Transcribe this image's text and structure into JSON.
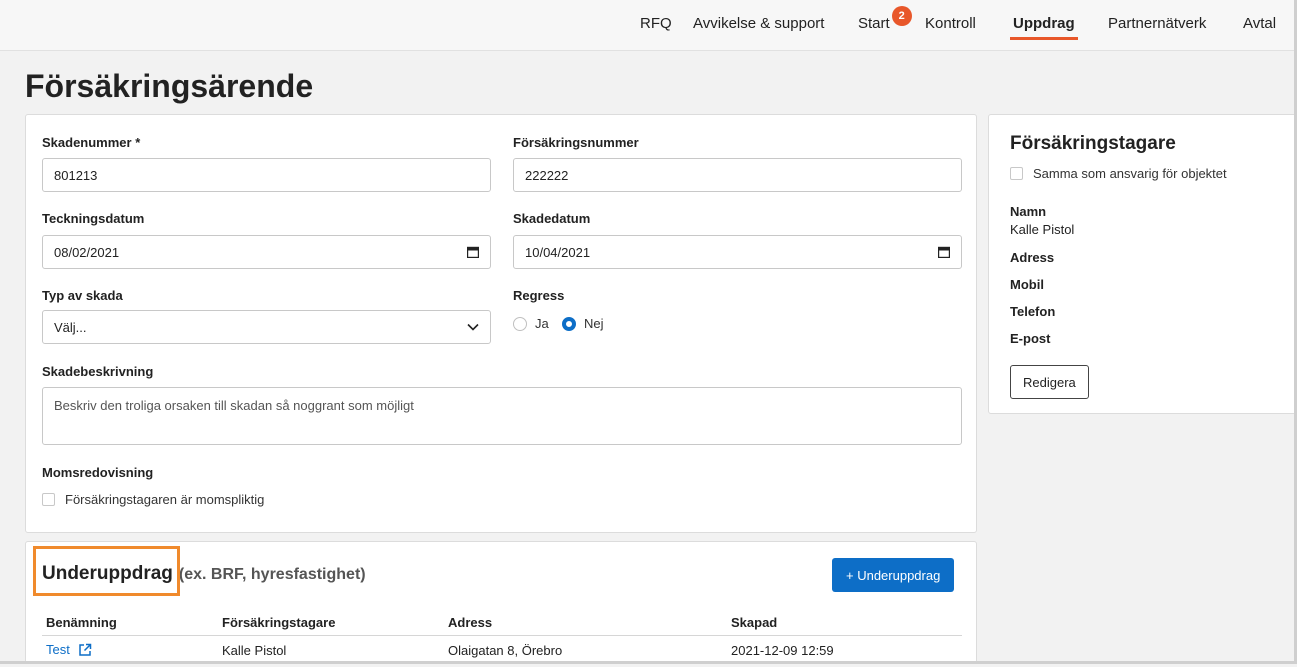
{
  "nav": {
    "items": [
      {
        "label": "RFQ"
      },
      {
        "label": "Avvikelse & support"
      },
      {
        "label": "Start",
        "badge": "2"
      },
      {
        "label": "Kontroll"
      },
      {
        "label": "Uppdrag",
        "active": true
      },
      {
        "label": "Partnernätverk"
      },
      {
        "label": "Avtal"
      }
    ],
    "accent_color": "#e8572a"
  },
  "page": {
    "title": "Försäkringsärende"
  },
  "form": {
    "skadenummer": {
      "label": "Skadenummer *",
      "value": "801213"
    },
    "forsakringsnummer": {
      "label": "Försäkringsnummer",
      "value": "222222"
    },
    "teckningsdatum": {
      "label": "Teckningsdatum",
      "value": "08/02/2021"
    },
    "skadedatum": {
      "label": "Skadedatum",
      "value": "10/04/2021"
    },
    "typ_av_skada": {
      "label": "Typ av skada",
      "value": "Välj..."
    },
    "regress": {
      "label": "Regress",
      "options": [
        "Ja",
        "Nej"
      ],
      "selected": "Nej"
    },
    "skadebeskrivning": {
      "label": "Skadebeskrivning",
      "placeholder": "Beskriv den troliga orsaken till skadan så noggrant som möjligt"
    },
    "momsredovisning": {
      "label": "Momsredovisning",
      "checkbox_label": "Försäkringstagaren är momspliktig",
      "checked": false
    }
  },
  "policyholder": {
    "title": "Försäkringstagare",
    "same_as_label": "Samma som ansvarig för objektet",
    "name_label": "Namn",
    "name_value": "Kalle Pistol",
    "address_label": "Adress",
    "mobile_label": "Mobil",
    "phone_label": "Telefon",
    "email_label": "E-post",
    "edit_button": "Redigera"
  },
  "subassignments": {
    "title": "Underuppdrag",
    "subtitle": "(ex. BRF, hyresfastighet)",
    "add_button": "+ Underuppdrag",
    "columns": [
      "Benämning",
      "Försäkringstagare",
      "Adress",
      "Skapad"
    ],
    "rows": [
      {
        "name": "Test",
        "holder": "Kalle Pistol",
        "address": "Olaigatan 8, Örebro",
        "created": "2021-12-09 12:59"
      }
    ]
  },
  "primary_color": "#0d6ec7",
  "highlight_color": "#f08a2c"
}
